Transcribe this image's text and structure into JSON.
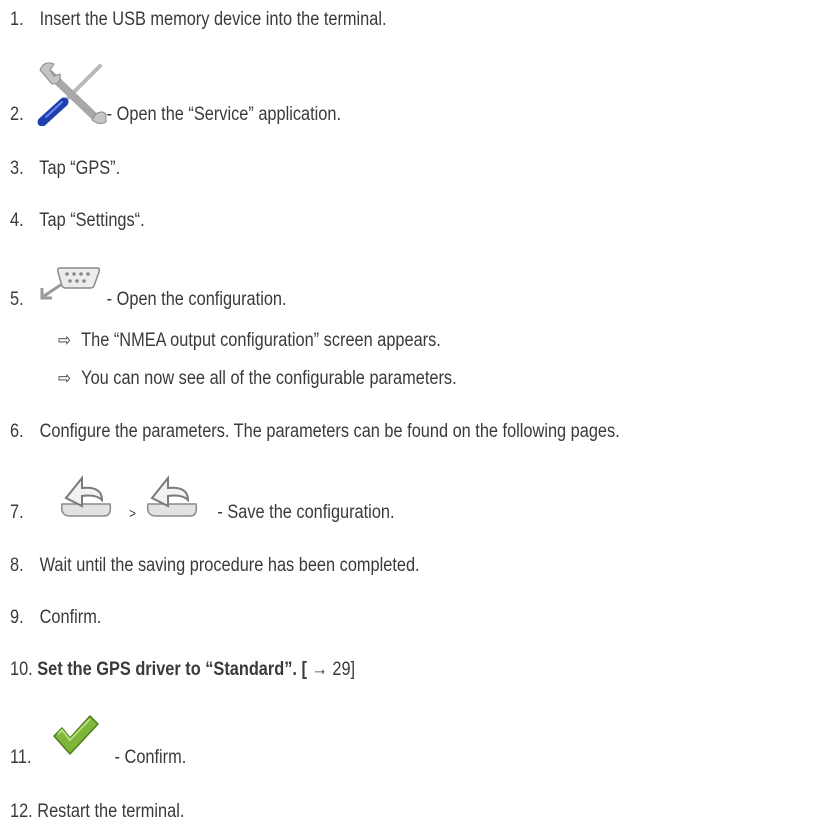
{
  "steps": [
    {
      "num": "1.",
      "text": "Insert the USB memory device into the terminal."
    },
    {
      "num": "2.",
      "text": "- Open the “Service” application.",
      "icon": "service-tools-icon"
    },
    {
      "num": "3.",
      "text": "Tap “GPS”."
    },
    {
      "num": "4.",
      "text": "Tap “Settings“."
    },
    {
      "num": "5.",
      "text": "- Open the configuration.",
      "icon": "serial-port-icon"
    },
    {
      "num": "6.",
      "text": "Configure the parameters. The parameters can be found on the following pages."
    },
    {
      "num": "7.",
      "separator": ">",
      "text": "- Save the configuration.",
      "icon": "back-arrow-icon"
    },
    {
      "num": "8.",
      "text": "Wait until the saving procedure has been completed."
    },
    {
      "num": "9.",
      "text": "Confirm."
    },
    {
      "num": "10.",
      "text": "Set the GPS driver to “Standard”. [",
      "arrow": "→",
      "page": "29]"
    },
    {
      "num": "11.",
      "text": "- Confirm.",
      "icon": "checkmark-icon"
    },
    {
      "num": "12.",
      "text": "Restart the terminal."
    }
  ],
  "results": [
    {
      "arrow": "⇨",
      "text": "The “NMEA output configuration” screen appears."
    },
    {
      "arrow": "⇨",
      "text": "You can now see all of the configurable parameters."
    }
  ],
  "colors": {
    "text": "#3a3a3a",
    "wrench_blue": "#1f3fb0",
    "check_green": "#7db63a",
    "icon_gray": "#c4c4c4"
  }
}
